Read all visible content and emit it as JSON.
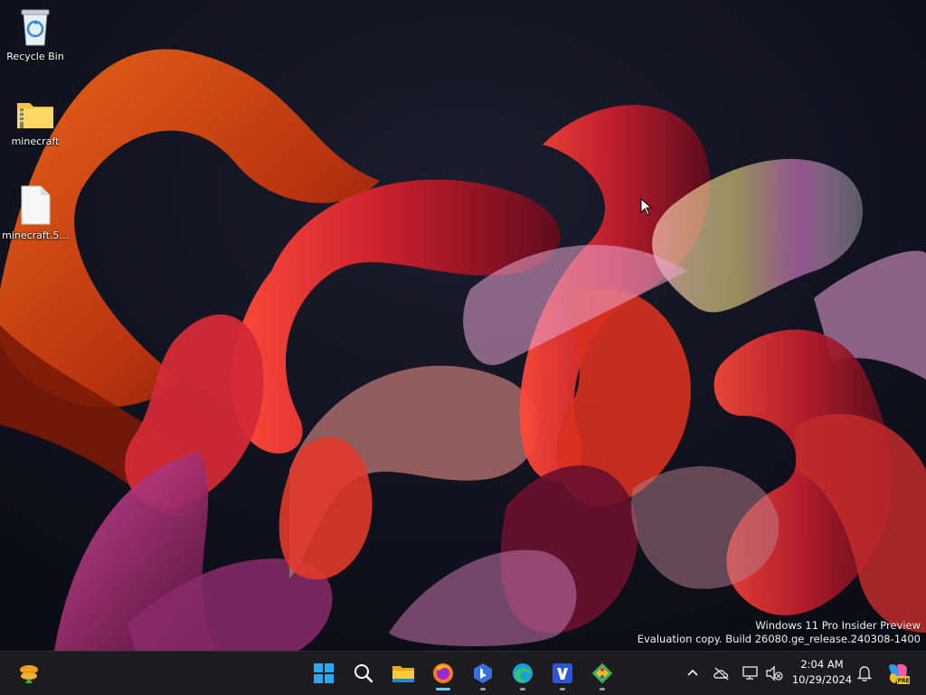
{
  "desktop": {
    "icons": [
      {
        "label": "Recycle Bin",
        "icon": "recycle-bin-icon"
      },
      {
        "label": "minecraft",
        "icon": "zip-folder-icon"
      },
      {
        "label": "minecraft.5...",
        "icon": "file-icon"
      }
    ],
    "watermark": {
      "line1": "Windows 11 Pro Insider Preview",
      "line2": "Evaluation copy. Build 26080.ge_release.240308-1400"
    }
  },
  "taskbar": {
    "widgets_icon": "widgets-icon",
    "apps": [
      {
        "name": "start-button",
        "icon": "windows-logo-icon"
      },
      {
        "name": "search-button",
        "icon": "search-icon"
      },
      {
        "name": "file-explorer-button",
        "icon": "folder-icon"
      },
      {
        "name": "firefox-button",
        "icon": "firefox-icon"
      },
      {
        "name": "bing-button",
        "icon": "bing-icon"
      },
      {
        "name": "edge-button",
        "icon": "edge-icon"
      },
      {
        "name": "vmware-button",
        "icon": "v-app-icon"
      },
      {
        "name": "git-button",
        "icon": "git-icon"
      }
    ],
    "clock": {
      "time": "2:04 AM",
      "date": "10/29/2024"
    },
    "tray": [
      {
        "name": "show-hidden-icons-button",
        "icon": "chevron-up-icon"
      },
      {
        "name": "onedrive-button",
        "icon": "cloud-off-icon"
      },
      {
        "name": "network-button",
        "icon": "network-icon"
      },
      {
        "name": "volume-button",
        "icon": "speaker-muted-icon"
      },
      {
        "name": "notifications-button",
        "icon": "bell-icon"
      },
      {
        "name": "copilot-button",
        "icon": "copilot-pre-icon"
      }
    ]
  },
  "colors": {
    "taskbar_bg": "#1c1c1f",
    "accent": "#60cdff",
    "wallpaper_bg": "#0d0f1a"
  }
}
